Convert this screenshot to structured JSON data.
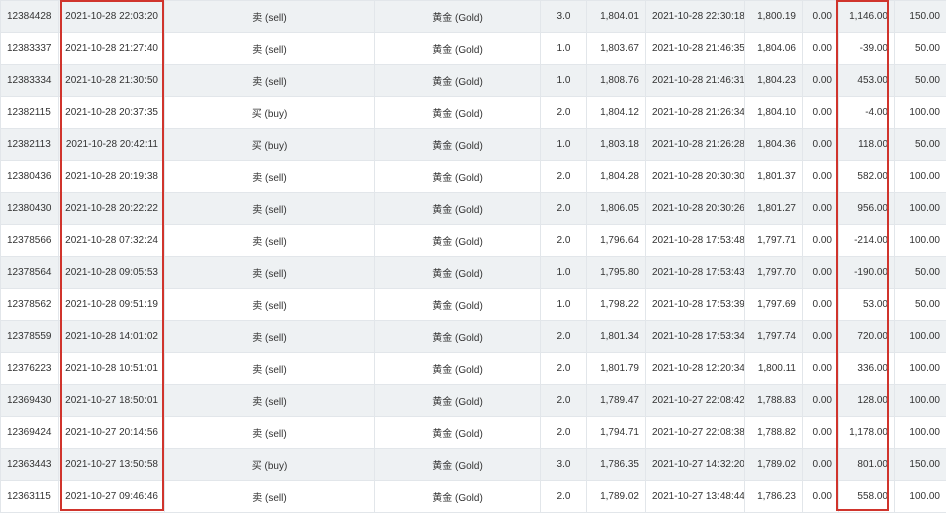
{
  "highlight_color": "#d0342c",
  "trades": [
    {
      "ticket": "12384428",
      "open_time": "2021-10-28 22:03:20",
      "type": "卖 (sell)",
      "symbol": "黄金 (Gold)",
      "volume": "3.0",
      "open_price": "1,804.01",
      "close_time": "2021-10-28 22:30:18",
      "close_price": "1,800.19",
      "commission": "0.00",
      "profit": "1,146.00",
      "points": "150.00"
    },
    {
      "ticket": "12383337",
      "open_time": "2021-10-28 21:27:40",
      "type": "卖 (sell)",
      "symbol": "黄金 (Gold)",
      "volume": "1.0",
      "open_price": "1,803.67",
      "close_time": "2021-10-28 21:46:35",
      "close_price": "1,804.06",
      "commission": "0.00",
      "profit": "-39.00",
      "points": "50.00"
    },
    {
      "ticket": "12383334",
      "open_time": "2021-10-28 21:30:50",
      "type": "卖 (sell)",
      "symbol": "黄金 (Gold)",
      "volume": "1.0",
      "open_price": "1,808.76",
      "close_time": "2021-10-28 21:46:31",
      "close_price": "1,804.23",
      "commission": "0.00",
      "profit": "453.00",
      "points": "50.00"
    },
    {
      "ticket": "12382115",
      "open_time": "2021-10-28 20:37:35",
      "type": "买 (buy)",
      "symbol": "黄金 (Gold)",
      "volume": "2.0",
      "open_price": "1,804.12",
      "close_time": "2021-10-28 21:26:34",
      "close_price": "1,804.10",
      "commission": "0.00",
      "profit": "-4.00",
      "points": "100.00"
    },
    {
      "ticket": "12382113",
      "open_time": "2021-10-28 20:42:11",
      "type": "买 (buy)",
      "symbol": "黄金 (Gold)",
      "volume": "1.0",
      "open_price": "1,803.18",
      "close_time": "2021-10-28 21:26:28",
      "close_price": "1,804.36",
      "commission": "0.00",
      "profit": "118.00",
      "points": "50.00"
    },
    {
      "ticket": "12380436",
      "open_time": "2021-10-28 20:19:38",
      "type": "卖 (sell)",
      "symbol": "黄金 (Gold)",
      "volume": "2.0",
      "open_price": "1,804.28",
      "close_time": "2021-10-28 20:30:30",
      "close_price": "1,801.37",
      "commission": "0.00",
      "profit": "582.00",
      "points": "100.00"
    },
    {
      "ticket": "12380430",
      "open_time": "2021-10-28 20:22:22",
      "type": "卖 (sell)",
      "symbol": "黄金 (Gold)",
      "volume": "2.0",
      "open_price": "1,806.05",
      "close_time": "2021-10-28 20:30:26",
      "close_price": "1,801.27",
      "commission": "0.00",
      "profit": "956.00",
      "points": "100.00"
    },
    {
      "ticket": "12378566",
      "open_time": "2021-10-28 07:32:24",
      "type": "卖 (sell)",
      "symbol": "黄金 (Gold)",
      "volume": "2.0",
      "open_price": "1,796.64",
      "close_time": "2021-10-28 17:53:48",
      "close_price": "1,797.71",
      "commission": "0.00",
      "profit": "-214.00",
      "points": "100.00"
    },
    {
      "ticket": "12378564",
      "open_time": "2021-10-28 09:05:53",
      "type": "卖 (sell)",
      "symbol": "黄金 (Gold)",
      "volume": "1.0",
      "open_price": "1,795.80",
      "close_time": "2021-10-28 17:53:43",
      "close_price": "1,797.70",
      "commission": "0.00",
      "profit": "-190.00",
      "points": "50.00"
    },
    {
      "ticket": "12378562",
      "open_time": "2021-10-28 09:51:19",
      "type": "卖 (sell)",
      "symbol": "黄金 (Gold)",
      "volume": "1.0",
      "open_price": "1,798.22",
      "close_time": "2021-10-28 17:53:39",
      "close_price": "1,797.69",
      "commission": "0.00",
      "profit": "53.00",
      "points": "50.00"
    },
    {
      "ticket": "12378559",
      "open_time": "2021-10-28 14:01:02",
      "type": "卖 (sell)",
      "symbol": "黄金 (Gold)",
      "volume": "2.0",
      "open_price": "1,801.34",
      "close_time": "2021-10-28 17:53:34",
      "close_price": "1,797.74",
      "commission": "0.00",
      "profit": "720.00",
      "points": "100.00"
    },
    {
      "ticket": "12376223",
      "open_time": "2021-10-28 10:51:01",
      "type": "卖 (sell)",
      "symbol": "黄金 (Gold)",
      "volume": "2.0",
      "open_price": "1,801.79",
      "close_time": "2021-10-28 12:20:34",
      "close_price": "1,800.11",
      "commission": "0.00",
      "profit": "336.00",
      "points": "100.00"
    },
    {
      "ticket": "12369430",
      "open_time": "2021-10-27 18:50:01",
      "type": "卖 (sell)",
      "symbol": "黄金 (Gold)",
      "volume": "2.0",
      "open_price": "1,789.47",
      "close_time": "2021-10-27 22:08:42",
      "close_price": "1,788.83",
      "commission": "0.00",
      "profit": "128.00",
      "points": "100.00"
    },
    {
      "ticket": "12369424",
      "open_time": "2021-10-27 20:14:56",
      "type": "卖 (sell)",
      "symbol": "黄金 (Gold)",
      "volume": "2.0",
      "open_price": "1,794.71",
      "close_time": "2021-10-27 22:08:38",
      "close_price": "1,788.82",
      "commission": "0.00",
      "profit": "1,178.00",
      "points": "100.00"
    },
    {
      "ticket": "12363443",
      "open_time": "2021-10-27 13:50:58",
      "type": "买 (buy)",
      "symbol": "黄金 (Gold)",
      "volume": "3.0",
      "open_price": "1,786.35",
      "close_time": "2021-10-27 14:32:20",
      "close_price": "1,789.02",
      "commission": "0.00",
      "profit": "801.00",
      "points": "150.00"
    },
    {
      "ticket": "12363115",
      "open_time": "2021-10-27 09:46:46",
      "type": "卖 (sell)",
      "symbol": "黄金 (Gold)",
      "volume": "2.0",
      "open_price": "1,789.02",
      "close_time": "2021-10-27 13:48:44",
      "close_price": "1,786.23",
      "commission": "0.00",
      "profit": "558.00",
      "points": "100.00"
    }
  ]
}
